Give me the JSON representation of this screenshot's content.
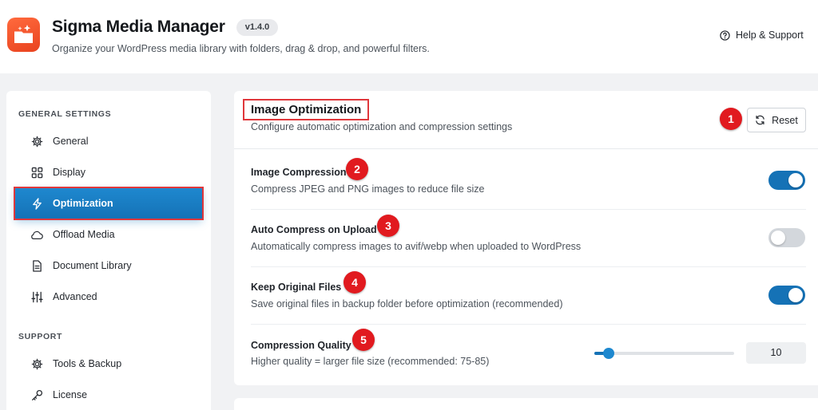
{
  "header": {
    "title": "Sigma Media Manager",
    "version": "v1.4.0",
    "subtitle": "Organize your WordPress media library with folders, drag & drop, and powerful filters.",
    "help_label": "Help & Support"
  },
  "sidebar": {
    "general_section": "GENERAL SETTINGS",
    "support_section": "SUPPORT",
    "items": [
      {
        "label": "General",
        "icon": "gear-icon"
      },
      {
        "label": "Display",
        "icon": "grid-icon"
      },
      {
        "label": "Optimization",
        "icon": "lightning-icon",
        "active": true
      },
      {
        "label": "Offload Media",
        "icon": "cloud-icon"
      },
      {
        "label": "Document Library",
        "icon": "document-icon"
      },
      {
        "label": "Advanced",
        "icon": "sliders-icon"
      }
    ],
    "support_items": [
      {
        "label": "Tools & Backup",
        "icon": "gear-icon"
      },
      {
        "label": "License",
        "icon": "key-icon"
      }
    ]
  },
  "panel": {
    "title": "Image Optimization",
    "description": "Configure automatic optimization and compression settings",
    "reset_label": "Reset",
    "settings": [
      {
        "label": "Image Compression",
        "description": "Compress JPEG and PNG images to reduce file size",
        "enabled": true,
        "badge": "2"
      },
      {
        "label": "Auto Compress on Upload",
        "description": "Automatically compress images to avif/webp when uploaded to WordPress",
        "enabled": false,
        "badge": "3"
      },
      {
        "label": "Keep Original Files",
        "description": "Save original files in backup folder before optimization (recommended)",
        "enabled": true,
        "badge": "4"
      }
    ],
    "quality": {
      "label": "Compression Quality",
      "description": "Higher quality = larger file size (recommended: 75-85)",
      "value": "10",
      "badge": "5",
      "slider_fraction": 0.1
    },
    "reset_badge": "1"
  },
  "colors": {
    "accent": "#1572b6",
    "highlight_border": "#e0373b",
    "badge": "#e11a1f",
    "logo": "#ff6a3d"
  }
}
